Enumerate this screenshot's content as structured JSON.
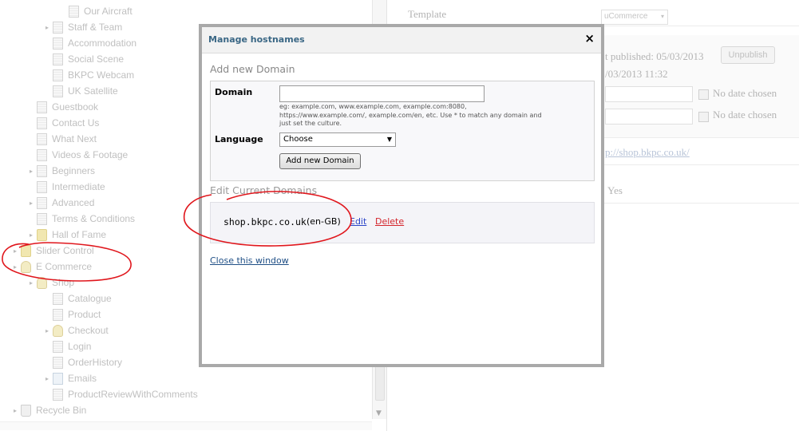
{
  "tree": {
    "items": [
      {
        "label": "Our Aircraft",
        "icon": "doc-icon",
        "expander": false
      },
      {
        "label": "Staff & Team",
        "icon": "doc-icon",
        "expander": true
      },
      {
        "label": "Accommodation",
        "icon": "doc-icon",
        "expander": false
      },
      {
        "label": "Social Scene",
        "icon": "doc-icon",
        "expander": false
      },
      {
        "label": "BKPC Webcam",
        "icon": "doc-icon",
        "expander": false
      },
      {
        "label": "UK Satellite",
        "icon": "doc-icon",
        "expander": false
      },
      {
        "label": "Guestbook",
        "icon": "doc-icon",
        "expander": false
      },
      {
        "label": "Contact Us",
        "icon": "doc-icon",
        "expander": false
      },
      {
        "label": "What Next",
        "icon": "doc-icon",
        "expander": false
      },
      {
        "label": "Videos & Footage",
        "icon": "doc-icon",
        "expander": false
      },
      {
        "label": "Beginners",
        "icon": "doc-icon",
        "expander": true
      },
      {
        "label": "Intermediate",
        "icon": "doc-icon",
        "expander": false
      },
      {
        "label": "Advanced",
        "icon": "doc-icon",
        "expander": true
      },
      {
        "label": "Terms & Conditions",
        "icon": "doc-icon",
        "expander": false
      },
      {
        "label": "Hall of Fame",
        "icon": "folder-icon",
        "expander": true
      },
      {
        "label": "Slider Control",
        "icon": "folder-icon",
        "expander": true
      },
      {
        "label": "E Commerce",
        "icon": "cube-icon",
        "expander": true
      },
      {
        "label": "Shop",
        "icon": "cube-icon",
        "expander": true
      },
      {
        "label": "Catalogue",
        "icon": "doc-icon",
        "expander": false
      },
      {
        "label": "Product",
        "icon": "doc-icon",
        "expander": false
      },
      {
        "label": "Checkout",
        "icon": "cube-icon",
        "expander": true
      },
      {
        "label": "Login",
        "icon": "doc-icon",
        "expander": false
      },
      {
        "label": "OrderHistory",
        "icon": "doc-icon",
        "expander": false
      },
      {
        "label": "Emails",
        "icon": "mail-icon",
        "expander": true
      },
      {
        "label": "ProductReviewWithComments",
        "icon": "doc-icon",
        "expander": false
      },
      {
        "label": "Recycle Bin",
        "icon": "bin-icon",
        "expander": true
      }
    ]
  },
  "properties": {
    "template_label": "Template",
    "template_value": "uCommerce",
    "last_published": "t published: 05/03/2013",
    "unpublish_label": "Unpublish",
    "last_edited": "/03/2013 11:32",
    "no_date_1": "No date chosen",
    "no_date_2": "No date chosen",
    "link_text": "p://shop.bkpc.co.uk/",
    "yes_text": "Yes"
  },
  "modal": {
    "title": "Manage hostnames",
    "close_symbol": "×",
    "add_heading": "Add new Domain",
    "domain_label": "Domain",
    "domain_value": "",
    "domain_help": "eg: example.com, www.example.com, example.com:8080, https://www.example.com/, example.com/en, etc. Use * to match any domain and just set the culture.",
    "language_label": "Language",
    "language_selected": "Choose",
    "add_button": "Add new Domain",
    "edit_heading": "Edit Current Domains",
    "domains": [
      {
        "name": "shop.bkpc.co.uk",
        "culture": "(en-GB)",
        "edit": "Edit",
        "delete": "Delete"
      }
    ],
    "close_link": "Close this window"
  },
  "colors": {
    "annotation": "#e0161c",
    "modal_title": "#3a6785",
    "delete_link": "#d4252c",
    "edit_link": "#2a44c8"
  }
}
